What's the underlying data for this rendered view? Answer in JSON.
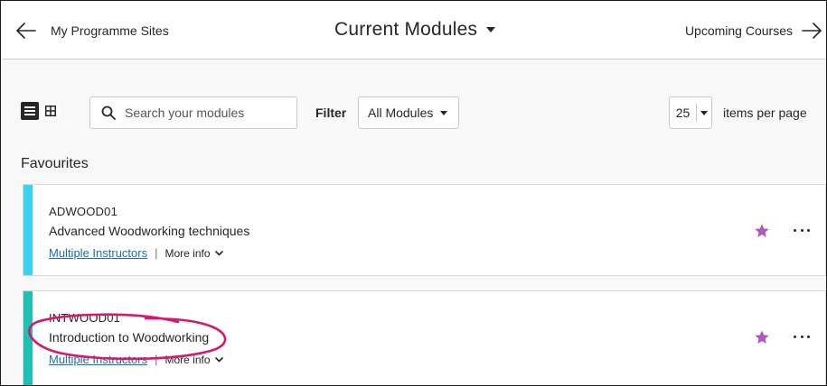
{
  "nav": {
    "back_label": "My Programme Sites",
    "title": "Current Modules",
    "forward_label": "Upcoming Courses"
  },
  "toolbar": {
    "view_list": "list-view-icon",
    "view_grid": "grid-view-icon",
    "search_placeholder": "Search your modules",
    "filter_label": "Filter",
    "filter_value": "All Modules",
    "page_size": "25",
    "page_size_label": "items per page"
  },
  "section": {
    "title": "Favourites"
  },
  "modules": [
    {
      "code": "ADWOOD01",
      "title": "Advanced Woodworking techniques",
      "instructors": "Multiple Instructors",
      "separator": "|",
      "more_info": "More info",
      "stripe_color": "#35d4f5",
      "favourite": true
    },
    {
      "code": "INTWOOD01",
      "title": "Introduction to Woodworking",
      "instructors": "Multiple Instructors",
      "separator": "|",
      "more_info": "More info",
      "stripe_color": "#1fc1b7",
      "favourite": true
    }
  ],
  "colors": {
    "star": "#b454c4",
    "link": "#1b6ea7",
    "annotation": "#d6186f"
  }
}
